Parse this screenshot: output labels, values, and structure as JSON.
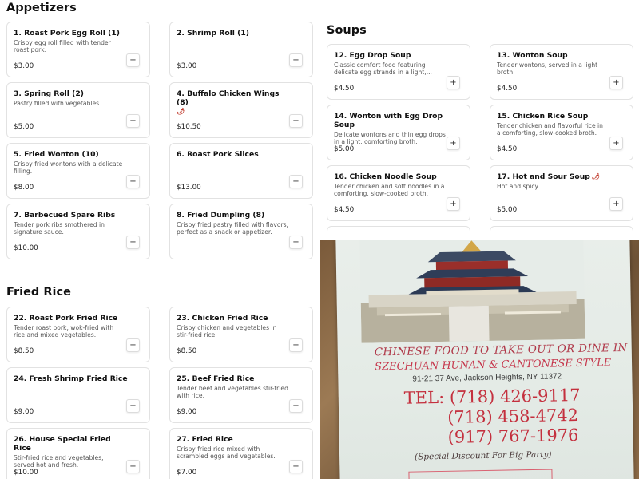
{
  "sections": {
    "appetizers": "Appetizers",
    "soups": "Soups",
    "fried_rice": "Fried Rice"
  },
  "appetizers": [
    {
      "title": "1. Roast Pork Egg Roll (1)",
      "desc": "Crispy egg roll filled with tender roast pork.",
      "price": "$3.00"
    },
    {
      "title": "2. Shrimp Roll (1)",
      "desc": "",
      "price": "$3.00"
    },
    {
      "title": "3. Spring Roll (2)",
      "desc": "Pastry filled with vegetables.",
      "price": "$5.00"
    },
    {
      "title": "4. Buffalo Chicken Wings (8)",
      "desc": "",
      "price": "$10.50",
      "spicy": true
    },
    {
      "title": "5. Fried Wonton (10)",
      "desc": "Crispy fried wontons with a delicate filling.",
      "price": "$8.00"
    },
    {
      "title": "6. Roast Pork Slices",
      "desc": "",
      "price": "$13.00"
    },
    {
      "title": "7. Barbecued Spare Ribs",
      "desc": "Tender pork ribs smothered in signature sauce.",
      "price": "$10.00"
    },
    {
      "title": "8. Fried Dumpling (8)",
      "desc": "Crispy fried pastry filled with flavors, perfect as a snack or appetizer.",
      "price": ""
    }
  ],
  "soups": [
    {
      "title": "12. Egg Drop Soup",
      "desc": "Classic comfort food featuring delicate egg strands in a light,...",
      "price": "$4.50"
    },
    {
      "title": "13. Wonton Soup",
      "desc": "Tender wontons, served in a light broth.",
      "price": "$4.50"
    },
    {
      "title": "14. Wonton with Egg Drop Soup",
      "desc": "Delicate wontons and thin egg drops in a light, comforting broth.",
      "price": "$5.00"
    },
    {
      "title": "15. Chicken Rice Soup",
      "desc": "Tender chicken and flavorful rice in a comforting, slow-cooked broth.",
      "price": "$4.50"
    },
    {
      "title": "16. Chicken Noodle Soup",
      "desc": "Tender chicken and soft noodles in a comforting, slow-cooked broth.",
      "price": "$4.50"
    },
    {
      "title": "17. Hot and Sour Soup",
      "desc": "Hot and spicy.",
      "price": "$5.00",
      "spicy": true
    }
  ],
  "fried_rice": [
    {
      "title": "22. Roast Pork Fried Rice",
      "desc": "Tender roast pork, wok-fried with rice and mixed vegetables.",
      "price": "$8.50"
    },
    {
      "title": "23. Chicken Fried Rice",
      "desc": "Crispy chicken and vegetables in stir-fried rice.",
      "price": "$8.50"
    },
    {
      "title": "24. Fresh Shrimp Fried Rice",
      "desc": "",
      "price": "$9.00"
    },
    {
      "title": "25. Beef Fried Rice",
      "desc": "Tender beef and vegetables stir-fried with rice.",
      "price": "$9.00"
    },
    {
      "title": "26. House Special Fried Rice",
      "desc": "Stir-fried rice and vegetables, served hot and fresh.",
      "price": "$10.00"
    },
    {
      "title": "27. Fried Rice",
      "desc": "Crispy fried rice mixed with scrambled eggs and vegetables.",
      "price": "$7.00"
    }
  ],
  "add_label": "+",
  "spicy_icon": "chili-pepper-icon",
  "flyer": {
    "line1": "CHINESE FOOD TO TAKE OUT OR DINE IN",
    "line2": "SZECHUAN HUNAN & CANTONESE STYLE",
    "address": "91-21 37 Ave, Jackson Heights, NY 11372",
    "tel_label": "TEL: (718) 426-9117",
    "phone2": "(718) 458-4742",
    "phone3": "(917) 767-1976",
    "discount": "(Special Discount For Big Party)"
  },
  "colors": {
    "flyer_red": "#c4303e",
    "card_border": "#e2e2e2"
  }
}
